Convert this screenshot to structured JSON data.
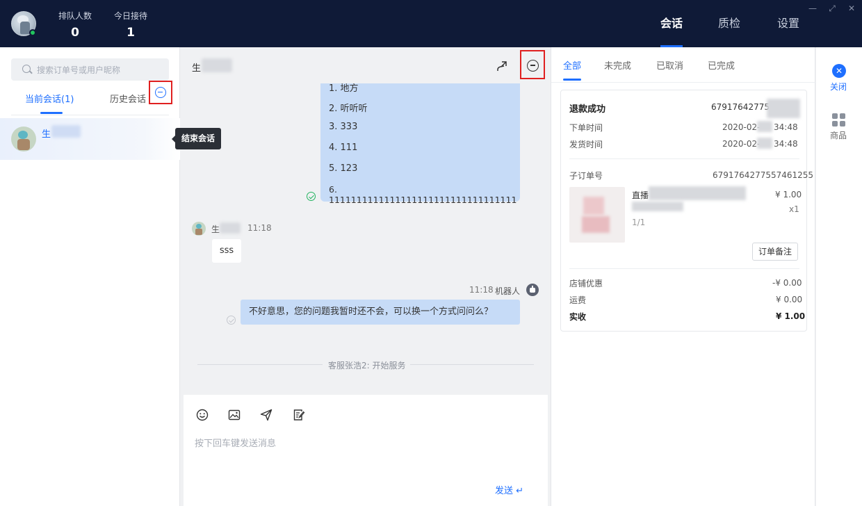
{
  "topbar": {
    "stats": [
      {
        "label": "排队人数",
        "value": "0"
      },
      {
        "label": "今日接待",
        "value": "1"
      }
    ],
    "nav": [
      {
        "label": "会话",
        "active": true
      },
      {
        "label": "质检",
        "active": false
      },
      {
        "label": "设置",
        "active": false
      }
    ],
    "window_controls": {
      "minimize": "—",
      "maximize": "⤢",
      "close": "✕"
    }
  },
  "left": {
    "search_placeholder": "搜索订单号或用户昵称",
    "tabs": [
      {
        "label": "当前会话(1)",
        "active": true
      },
      {
        "label": "历史会话",
        "active": false
      }
    ],
    "session": {
      "name": "生"
    },
    "tooltip": "结束会话"
  },
  "chat": {
    "header_name": "生",
    "list_lines": [
      "1. 地方",
      "2. 听听听",
      "3. 333",
      "4. 111",
      "5. 123",
      "6. 1111111111111111111111111111111111"
    ],
    "customer": {
      "name": "生",
      "time": "11:18",
      "message": "sss"
    },
    "bot": {
      "time": "11:18",
      "name": "机器人",
      "message": "不好意思，您的问题我暂时还不会，可以换一个方式问问么？"
    },
    "system_message": "客服张浩2: 开始服务",
    "composer": {
      "placeholder": "按下回车键发送消息",
      "send_label": "发送 ↵",
      "tools": [
        "emoji-icon",
        "image-icon",
        "send-plane-icon",
        "edit-note-icon"
      ]
    }
  },
  "order": {
    "tabs": [
      {
        "label": "全部",
        "active": true
      },
      {
        "label": "未完成",
        "active": false
      },
      {
        "label": "已取消",
        "active": false
      },
      {
        "label": "已完成",
        "active": false
      }
    ],
    "status": "退款成功",
    "order_id": "679176427755",
    "order_time_label": "下单时间",
    "order_time_value_a": "2020-02-",
    "order_time_value_b": "34:48",
    "ship_time_label": "发货时间",
    "ship_time_value_a": "2020-02-",
    "ship_time_value_b": "34:48",
    "sub_order_label": "子订单号",
    "sub_order_id": "6791764277557461255",
    "product": {
      "title": "直播",
      "price": "¥ 1.00",
      "qty": "x1",
      "page": "1/1"
    },
    "remark_button": "订单备注",
    "shop_discount_label": "店铺优惠",
    "shop_discount_value": "-¥ 0.00",
    "shipping_label": "运费",
    "shipping_value": "¥ 0.00",
    "paid_label": "实收",
    "paid_value": "¥ 1.00"
  },
  "sidebar": {
    "close_label": "关闭",
    "goods_label": "商品"
  },
  "colors": {
    "topbar_bg": "#0f1a37",
    "accent": "#1e6fff",
    "bubble_blue": "#c6dbf7",
    "highlight_red": "#e02020",
    "online_green": "#22c55e"
  }
}
